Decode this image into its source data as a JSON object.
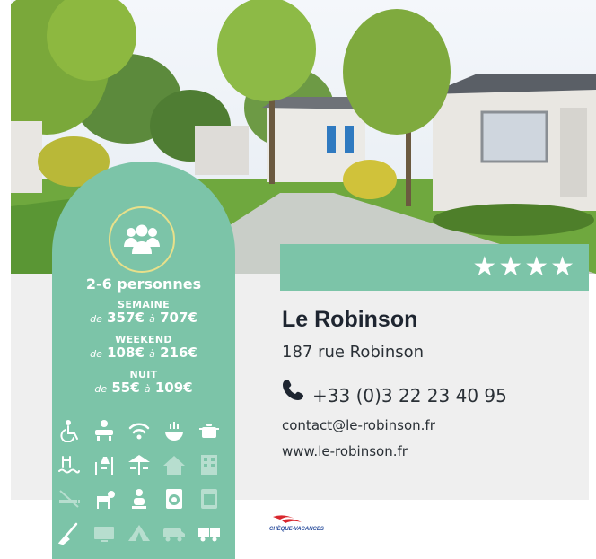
{
  "rating": {
    "stars": "★★★★"
  },
  "capacity": "2-6 personnes",
  "prices": {
    "semaine": {
      "label": "SEMAINE",
      "de": "de",
      "from": "357€",
      "a": "à",
      "to": "707€"
    },
    "weekend": {
      "label": "WEEKEND",
      "de": "de",
      "from": "108€",
      "a": "à",
      "to": "216€"
    },
    "nuit": {
      "label": "NUIT",
      "de": "de",
      "from": "55€",
      "a": "à",
      "to": "109€"
    }
  },
  "camping": {
    "name": "Le Robinson",
    "address": "187 rue Robinson",
    "phone": "+33 (0)3 22 23 40 95",
    "email": "contact@le-robinson.fr",
    "website": "www.le-robinson.fr"
  },
  "logo": {
    "text": "CHÈQUE-VACANCES"
  },
  "amenities": [
    {
      "icon": "wheelchair-icon",
      "available": true
    },
    {
      "icon": "kids-club-icon",
      "available": true
    },
    {
      "icon": "wifi-icon",
      "available": true
    },
    {
      "icon": "restaurant-icon",
      "available": true
    },
    {
      "icon": "cooking-pot-icon",
      "available": true
    },
    {
      "icon": "pool-icon",
      "available": true
    },
    {
      "icon": "playground-icon",
      "available": true
    },
    {
      "icon": "terrace-icon",
      "available": true
    },
    {
      "icon": "house-icon",
      "available": false
    },
    {
      "icon": "building-icon",
      "available": false
    },
    {
      "icon": "no-smoking-icon",
      "available": false
    },
    {
      "icon": "dog-icon",
      "available": true
    },
    {
      "icon": "baby-icon",
      "available": true
    },
    {
      "icon": "washing-machine-icon",
      "available": true
    },
    {
      "icon": "dryer-icon",
      "available": false
    },
    {
      "icon": "cleaning-icon",
      "available": true
    },
    {
      "icon": "tv-icon",
      "available": false
    },
    {
      "icon": "tent-icon",
      "available": false
    },
    {
      "icon": "camper-van-icon",
      "available": false
    },
    {
      "icon": "caravan-icon",
      "available": true
    }
  ],
  "colors": {
    "accent": "#7cc4a8",
    "info_bg": "#efefef",
    "text": "#2a3036"
  }
}
